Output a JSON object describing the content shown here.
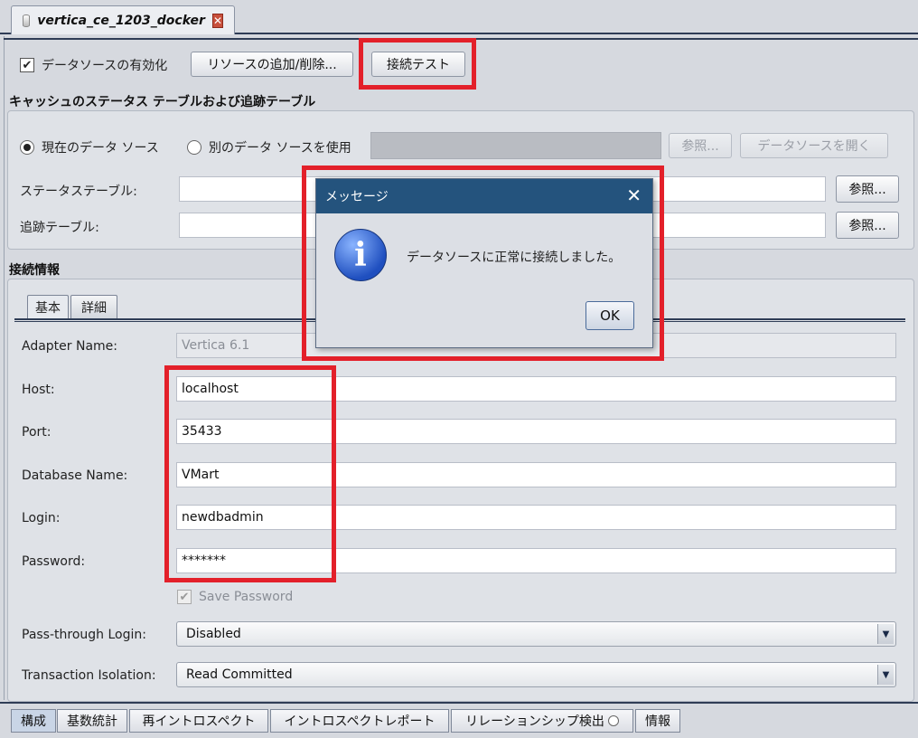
{
  "doc_tab": {
    "title": "vertica_ce_1203_docker",
    "close_symbol": "✕"
  },
  "toolbar": {
    "enable_label": "データソースの有効化",
    "enable_checked": true,
    "add_remove_label": "リソースの追加/削除...",
    "test_label": "接続テスト"
  },
  "cache_section": {
    "title": "キャッシュのステータス テーブルおよび追跡テーブル",
    "radio_current": "現在のデータ ソース",
    "radio_other": "別のデータ ソースを使用",
    "browse_label": "参照...",
    "open_ds_label": "データソースを開く",
    "status_table_label": "ステータステーブル:",
    "tracking_table_label": "追跡テーブル:",
    "status_table_value": "",
    "tracking_table_value": ""
  },
  "connection": {
    "title": "接続情報",
    "tabs": [
      "基本",
      "詳細"
    ],
    "adapter_label": "Adapter Name:",
    "adapter_value": "Vertica 6.1",
    "host_label": "Host:",
    "host_value": "localhost",
    "port_label": "Port:",
    "port_value": "35433",
    "db_label": "Database Name:",
    "db_value": "VMart",
    "login_label": "Login:",
    "login_value": "newdbadmin",
    "password_label": "Password:",
    "password_value": "*******",
    "save_password_label": "Save Password",
    "passthrough_label": "Pass-through Login:",
    "passthrough_value": "Disabled",
    "isolation_label": "Transaction Isolation:",
    "isolation_value": "Read Committed"
  },
  "dialog": {
    "title": "メッセージ",
    "close_symbol": "✕",
    "message": "データソースに正常に接続しました。",
    "ok_label": "OK"
  },
  "bottom_tabs": [
    "構成",
    "基数統計",
    "再イントロスペクト",
    "イントロスペクトレポート",
    "リレーションシップ検出",
    "情報"
  ],
  "colors": {
    "highlight": "#e3202a",
    "dialog_title_bg": "#24537d"
  }
}
